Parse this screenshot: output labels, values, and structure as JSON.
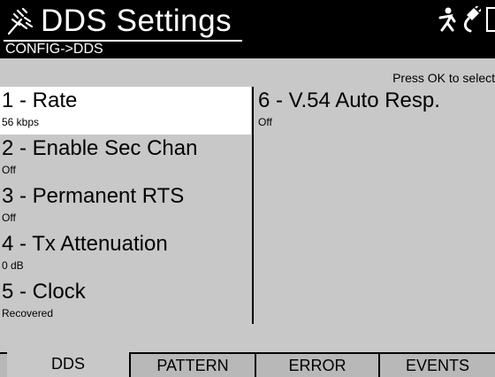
{
  "header": {
    "title": "DDS Settings",
    "breadcrumb": "CONFIG->DDS",
    "icons": [
      "dds-logo-icon",
      "person-running-icon",
      "plug-icon",
      "battery-icon"
    ]
  },
  "hint": "Press OK to select",
  "items_left": [
    {
      "label": "1 - Rate",
      "value": "56 kbps",
      "selected": true
    },
    {
      "label": "2 - Enable Sec Chan",
      "value": "Off"
    },
    {
      "label": "3 - Permanent RTS",
      "value": "Off"
    },
    {
      "label": "4 - Tx Attenuation",
      "value": "0 dB"
    },
    {
      "label": "5 - Clock",
      "value": "Recovered"
    }
  ],
  "items_right": [
    {
      "label": "6 - V.54 Auto Resp.",
      "value": "Off"
    }
  ],
  "tabs": [
    {
      "label": "DDS",
      "active": true
    },
    {
      "label": "PATTERN"
    },
    {
      "label": "ERROR"
    },
    {
      "label": "EVENTS"
    }
  ]
}
